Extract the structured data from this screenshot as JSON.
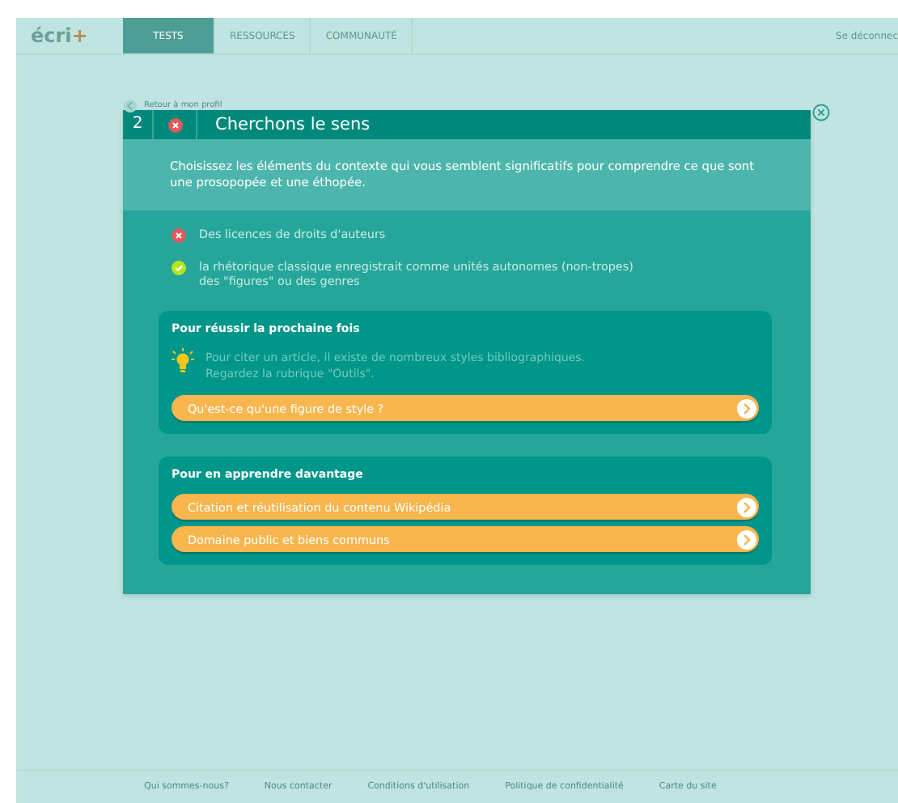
{
  "header": {
    "logo": "écri",
    "logo_plus": "+",
    "tabs": [
      {
        "label": "TESTS",
        "selected": true
      },
      {
        "label": "RESSOURCES",
        "selected": false
      },
      {
        "label": "COMMUNAUTÉ",
        "selected": false
      }
    ],
    "logout": "Se déconnec"
  },
  "back_link": "Retour à mon profil",
  "question": {
    "number": "2",
    "correct": false,
    "title": "Cherchons le sens",
    "prompt": "Choisissez les éléments du contexte qui vous semblent significatifs pour comprendre ce que sont une prosopopée et une éthopée.",
    "answers": [
      {
        "text": "Des licences de droits d'auteurs",
        "correct": false
      },
      {
        "text": "la rhétorique classique enregistrait comme unités autonomes (non-tropes)\ndes \"figures\" ou des genres",
        "correct": true
      }
    ]
  },
  "panels": [
    {
      "title": "Pour réussir la prochaine fois",
      "tip": "Pour citer un article, il existe de nombreux styles bibliographiques.\nRegardez la rubrique \"Outils\".",
      "links": [
        "Qu'est-ce qu'une figure de style ?"
      ]
    },
    {
      "title": "Pour en apprendre davantage",
      "links": [
        "Citation et réutilisation du contenu Wikipédia",
        "Domaine public et biens communs"
      ]
    }
  ],
  "footer": [
    "Qui sommes-nous?",
    "Nous contacter",
    "Conditions d'utilisation",
    "Politique de confidentialité",
    "Carte du site"
  ]
}
